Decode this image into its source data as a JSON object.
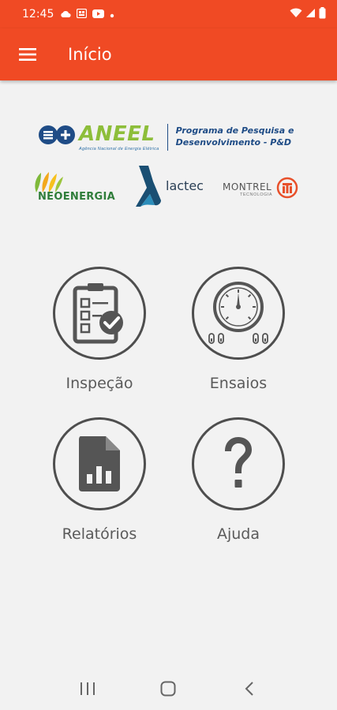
{
  "status_bar": {
    "time": "12:45",
    "left_icons": [
      "cloud-icon",
      "gallery-icon",
      "youtube-icon",
      "dot-icon"
    ],
    "right_icons": [
      "wifi-icon",
      "signal-icon",
      "battery-icon"
    ]
  },
  "app_bar": {
    "title": "Início",
    "menu_icon": "hamburger-menu-icon",
    "color": "#f04a24"
  },
  "logos": {
    "aneel": {
      "name": "ANEEL",
      "subtitle": "Agência Nacional de Energia Elétrica",
      "program_line1": "Programa de Pesquisa e",
      "program_line2": "Desenvolvimento - P&D"
    },
    "neoenergia": "NEOENERGIA",
    "lactec": "lactec",
    "montrel": {
      "name": "MONTREL",
      "sub": "TECNOLOGIA"
    }
  },
  "menu": {
    "items": [
      {
        "label": "Inspeção",
        "icon": "checklist-clipboard-icon"
      },
      {
        "label": "Ensaios",
        "icon": "gauge-meter-icon"
      },
      {
        "label": "Relatórios",
        "icon": "report-document-icon"
      },
      {
        "label": "Ajuda",
        "icon": "help-question-icon"
      }
    ]
  },
  "nav_bar": {
    "buttons": [
      "recent-apps-icon",
      "home-icon",
      "back-icon"
    ]
  }
}
